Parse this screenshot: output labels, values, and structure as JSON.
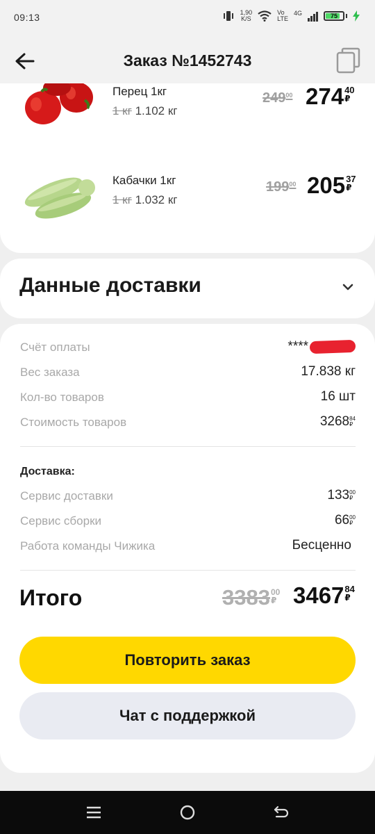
{
  "status_bar": {
    "time": "09:13",
    "net_speed": "1,90",
    "net_unit": "K/S",
    "volte_top": "Vo",
    "volte_bottom": "LTE",
    "network": "4G",
    "battery": "75"
  },
  "header": {
    "title": "Заказ №1452743"
  },
  "products": [
    {
      "name": "Перец 1кг",
      "qty_strike": "1 кг",
      "qty": "1.102 кг",
      "old_int": "249",
      "old_dec": "00",
      "price_int": "274",
      "price_dec": "40",
      "currency": "₽"
    },
    {
      "name": "Кабачки 1кг",
      "qty_strike": "1 кг",
      "qty": "1.032 кг",
      "old_int": "199",
      "old_dec": "00",
      "price_int": "205",
      "price_dec": "37",
      "currency": "₽"
    }
  ],
  "delivery": {
    "title": "Данные доставки"
  },
  "summary": {
    "rows": [
      {
        "label": "Счёт оплаты",
        "value": "****"
      },
      {
        "label": "Вес заказа",
        "value": "17.838 кг"
      },
      {
        "label": "Кол-во товаров",
        "value": "16 шт"
      },
      {
        "label": "Стоимость товаров",
        "value_int": "3268",
        "value_dec": "84",
        "currency": "₽"
      }
    ],
    "delivery_label": "Доставка:",
    "delivery_rows": [
      {
        "label": "Сервис доставки",
        "value_int": "133",
        "value_dec": "00",
        "currency": "₽"
      },
      {
        "label": "Сервис сборки",
        "value_int": "66",
        "value_dec": "00",
        "currency": "₽"
      },
      {
        "label": "Работа команды Чижика",
        "value": "Бесценно"
      }
    ],
    "total_label": "Итого",
    "total_old_int": "3383",
    "total_old_dec": "00",
    "total_int": "3467",
    "total_dec": "84",
    "currency": "₽"
  },
  "buttons": {
    "repeat": "Повторить заказ",
    "chat": "Чат с поддержкой"
  },
  "colors": {
    "accent": "#ffd800",
    "secondary_button": "#e9ebf2",
    "redaction": "#e8222f"
  }
}
